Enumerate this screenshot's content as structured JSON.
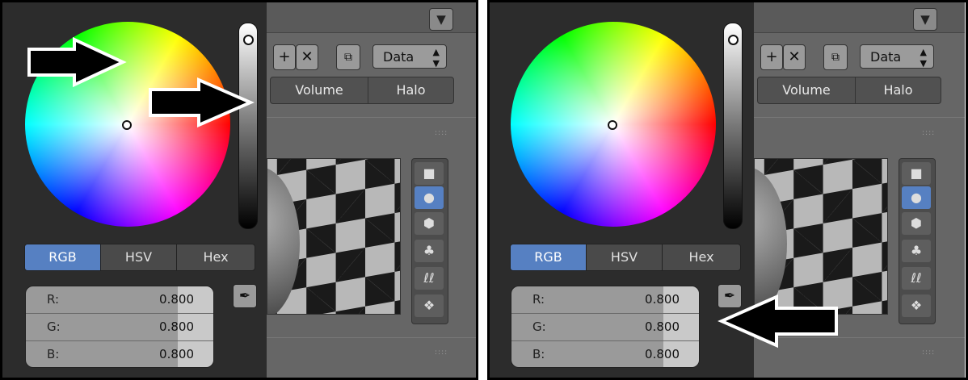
{
  "properties": {
    "add_icon": "plus-icon",
    "remove_icon": "x-icon",
    "browse_icon": "browse-icon",
    "data_select": "Data",
    "tabs": [
      "Volume",
      "Halo"
    ]
  },
  "popup": {
    "modes": [
      "RGB",
      "HSV",
      "Hex"
    ],
    "active_mode": "RGB",
    "channels": [
      {
        "label": "R:",
        "value": "0.800"
      },
      {
        "label": "G:",
        "value": "0.800"
      },
      {
        "label": "B:",
        "value": "0.800"
      }
    ],
    "value_level": 0.8
  },
  "colors": {
    "accent": "#5680c2",
    "arrow_fill": "#000000",
    "arrow_outline": "#ffffff"
  }
}
